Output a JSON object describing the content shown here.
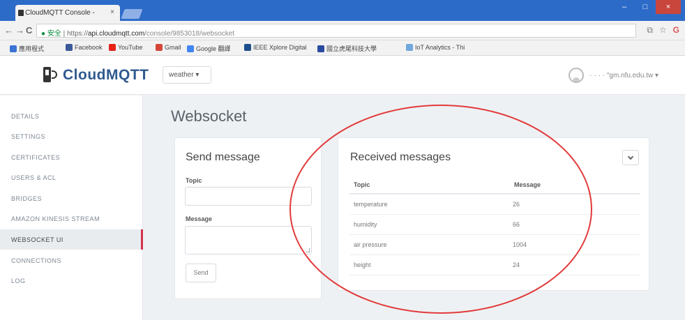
{
  "browser": {
    "tab_title": "CloudMQTT Console -",
    "tab_close": "×",
    "window_buttons": [
      "–",
      "□",
      "×"
    ],
    "nav": {
      "back": "←",
      "forward": "→",
      "reload": "C"
    },
    "address": {
      "security": "● 安全",
      "sep": " | ",
      "scheme": "https://",
      "host": "api.cloudmqtt.com",
      "path": "/console/9853018/websocket"
    },
    "bookmarks": [
      {
        "label": "應用程式",
        "color": "#3b73d6"
      },
      {
        "label": "Facebook",
        "color": "#3b5998"
      },
      {
        "label": "YouTube",
        "color": "#e62117"
      },
      {
        "label": "Gmail",
        "color": "#d44638"
      },
      {
        "label": "Google 翻譯",
        "color": "#4285f4"
      },
      {
        "label": "IEEE Xplore Digital",
        "color": "#1f4e8c"
      },
      {
        "label": "國立虎尾科技大學",
        "color": "#2a4aa0"
      },
      {
        "label": "IoT Analytics - Thi",
        "color": "#6fa8dc"
      }
    ]
  },
  "header": {
    "app_name": "CloudMQTT",
    "instance": "weather ▾",
    "user_email": "· · · · \"gm.nfu.edu.tw ▾"
  },
  "sidebar": {
    "items": [
      {
        "label": "DETAILS",
        "active": false
      },
      {
        "label": "SETTINGS",
        "active": false
      },
      {
        "label": "CERTIFICATES",
        "active": false
      },
      {
        "label": "USERS & ACL",
        "active": false
      },
      {
        "label": "BRIDGES",
        "active": false
      },
      {
        "label": "AMAZON KINESIS STREAM",
        "active": false
      },
      {
        "label": "WEBSOCKET UI",
        "active": true
      },
      {
        "label": "CONNECTIONS",
        "active": false
      },
      {
        "label": "LOG",
        "active": false
      }
    ]
  },
  "main": {
    "title": "Websocket",
    "send": {
      "title": "Send message",
      "topic_label": "Topic",
      "topic_value": "",
      "message_label": "Message",
      "message_value": "",
      "send_label": "Send"
    },
    "received": {
      "title": "Received messages",
      "columns": [
        "Topic",
        "Message"
      ],
      "rows": [
        {
          "topic": "temperature",
          "message": "26"
        },
        {
          "topic": "humidity",
          "message": "66"
        },
        {
          "topic": "air pressure",
          "message": "1004"
        },
        {
          "topic": "height",
          "message": "24"
        }
      ]
    }
  },
  "annotation": {
    "color": "#e23a3a"
  }
}
